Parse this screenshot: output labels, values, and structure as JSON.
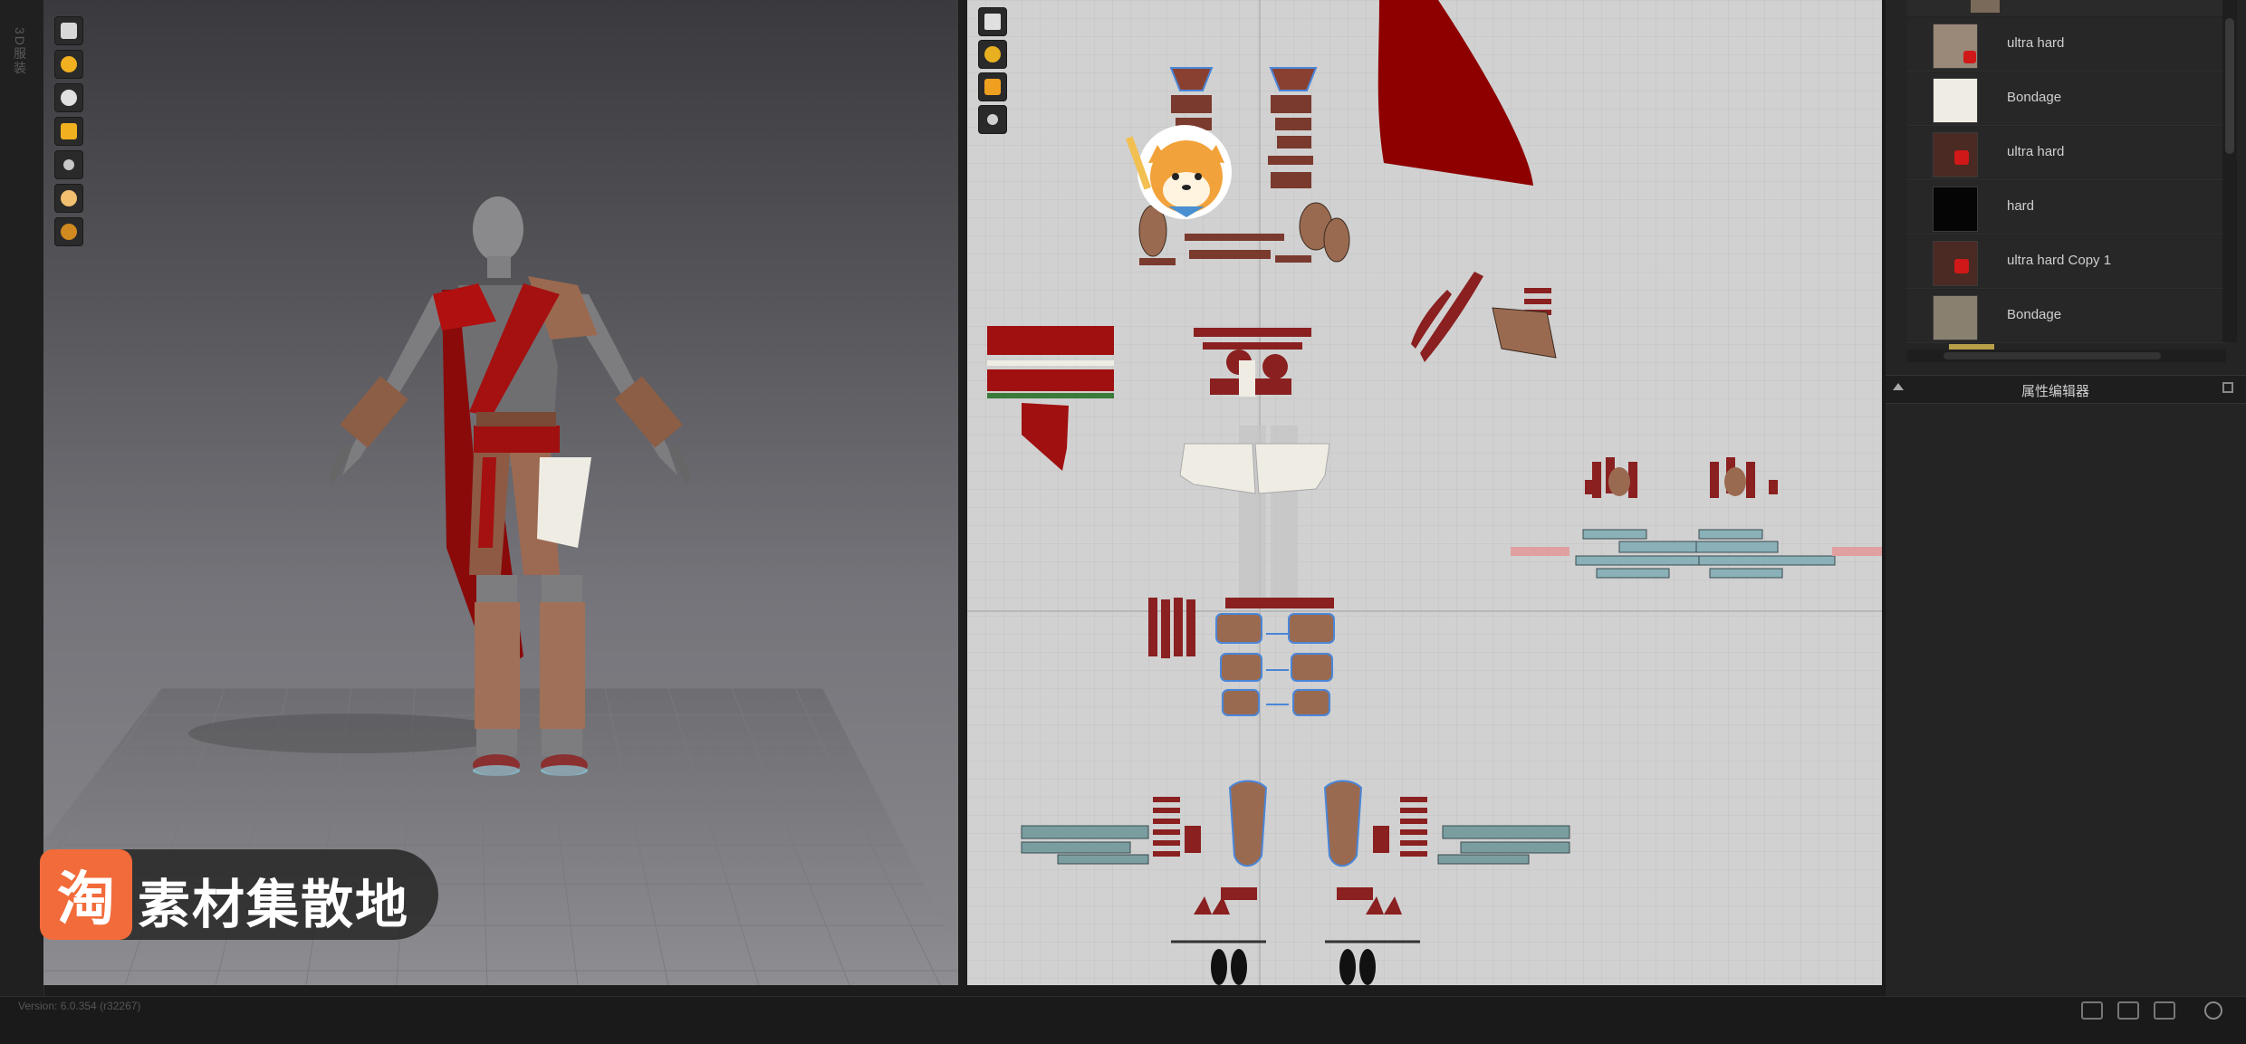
{
  "left_strip": {
    "text": "3D服装"
  },
  "toolbar_3d": {
    "icons": [
      "garment-icon",
      "rotate-icon",
      "avatar-icon",
      "texture-icon",
      "pin-icon",
      "face-icon",
      "skin-icon"
    ]
  },
  "toolbar_2d": {
    "icons": [
      "select-icon",
      "transform-icon",
      "segment-icon",
      "point-icon"
    ]
  },
  "materials": {
    "items": [
      {
        "label": "ultra hard",
        "thumb": "#9a8878",
        "badge": true
      },
      {
        "label": "Bondage",
        "thumb": "#efece4",
        "badge": false
      },
      {
        "label": "ultra hard",
        "thumb": "#4a2a22",
        "badge": true
      },
      {
        "label": "hard",
        "thumb": "#050505",
        "badge": false
      },
      {
        "label": "ultra hard Copy 1",
        "thumb": "#4a2a22",
        "badge": true
      },
      {
        "label": "Bondage",
        "thumb": "#8a8070",
        "badge": false
      }
    ]
  },
  "property_editor": {
    "title": "属性编辑器"
  },
  "status_bar": {
    "version": "Version: 6.0.354 (r32267)"
  },
  "watermark": {
    "logo": "淘",
    "text": "素材集散地"
  },
  "colors": {
    "accent_red": "#9a0000",
    "fabric_white": "#efece4",
    "blue_outline": "#4a86d8",
    "panel_bg": "#242424"
  }
}
